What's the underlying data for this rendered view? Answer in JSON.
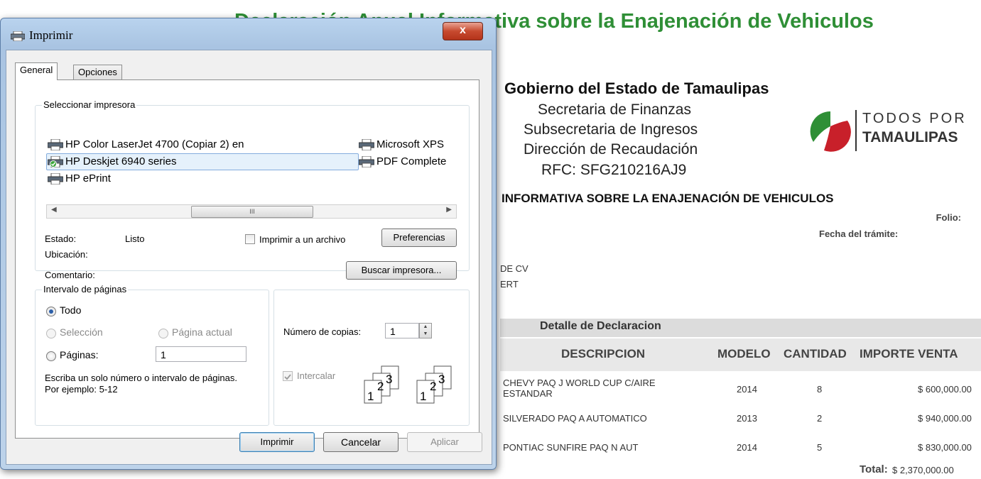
{
  "document": {
    "title": "Declaración Anual Informativa sobre la Enajenación de Vehiculos",
    "government": "Gobierno del Estado de Tamaulipas",
    "sub_lines": [
      "Secretaria de Finanzas",
      "Subsecretaria de Ingresos",
      "Dirección de Recaudación",
      "RFC: SFG210216AJ9"
    ],
    "logo_top": "TODOS POR",
    "logo_bottom": "TAMAULIPAS",
    "informativa": "INFORMATIVA SOBRE LA ENAJENACIÓN DE VEHICULOS",
    "folio_label": "Folio:",
    "fecha_label": "Fecha del trámite:",
    "partial_line1": "DE CV",
    "partial_line2": "ERT",
    "detalle_title": "Detalle de Declaracion",
    "columns": [
      "DESCRIPCION",
      "MODELO",
      "CANTIDAD",
      "IMPORTE VENTA"
    ],
    "rows": [
      {
        "descripcion": "CHEVY PAQ J WORLD CUP C/AIRE ESTANDAR",
        "modelo": "2014",
        "cantidad": "8",
        "importe": "$ 600,000.00"
      },
      {
        "descripcion": "SILVERADO PAQ A AUTOMATICO",
        "modelo": "2013",
        "cantidad": "2",
        "importe": "$ 940,000.00"
      },
      {
        "descripcion": "PONTIAC SUNFIRE PAQ N AUT",
        "modelo": "2014",
        "cantidad": "5",
        "importe": "$ 830,000.00"
      }
    ],
    "total_label": "Total:",
    "total_value": "$ 2,370,000.00"
  },
  "dialog": {
    "title": "Imprimir",
    "close_label": "x",
    "tabs": [
      "General",
      "Opciones"
    ],
    "printer_group_label": "Seleccionar impresora",
    "printers": [
      {
        "name": "HP Color LaserJet 4700 (Copiar 2) en"
      },
      {
        "name": "HP Deskjet 6940 series"
      },
      {
        "name": "HP ePrint"
      },
      {
        "name": "Microsoft XPS"
      },
      {
        "name": "PDF Complete"
      }
    ],
    "scroll_thumb": "III",
    "estado_label": "Estado:",
    "estado_value": "Listo",
    "ubicacion_label": "Ubicación:",
    "comentario_label": "Comentario:",
    "print_to_file_label": "Imprimir a un archivo",
    "preferences_label": "Preferencias",
    "find_printer_label": "Buscar impresora...",
    "range_group_label": "Intervalo de páginas",
    "range_all": "Todo",
    "range_selection": "Selección",
    "range_current": "Página actual",
    "range_pages": "Páginas:",
    "pages_value": "1",
    "range_hint": "Escriba un solo número o intervalo de páginas. Por ejemplo: 5-12",
    "copies_label": "Número de copias:",
    "copies_value": "1",
    "collate_label": "Intercalar",
    "btn_print": "Imprimir",
    "btn_cancel": "Cancelar",
    "btn_apply": "Aplicar"
  },
  "colors": {
    "title_green": "#2f8f36",
    "dialog_frame": "#b9d3ee",
    "close_red": "#c74a2f",
    "logo_green": "#2f8f36",
    "logo_red": "#c8202a"
  }
}
